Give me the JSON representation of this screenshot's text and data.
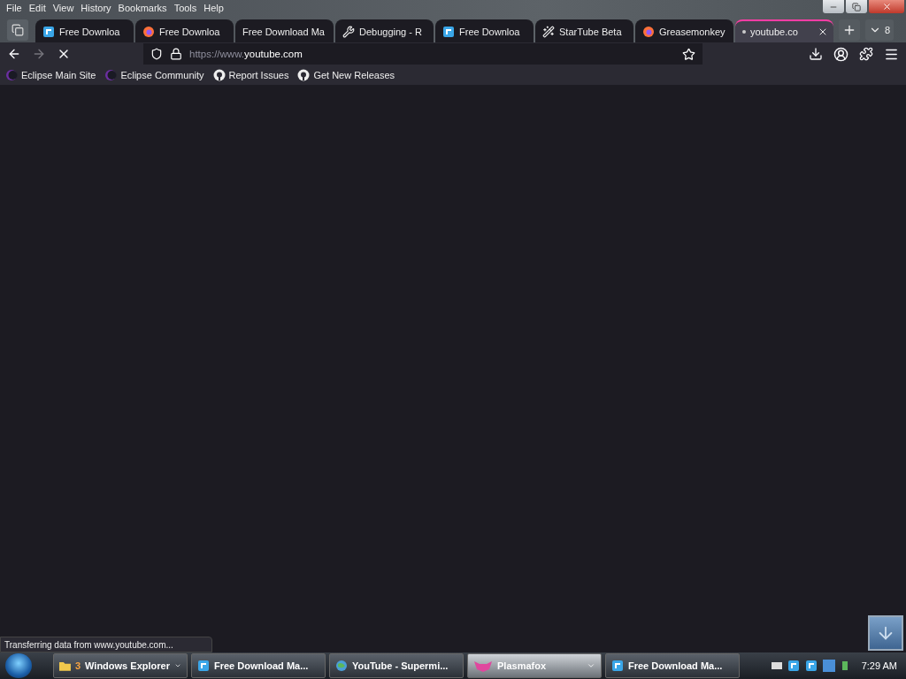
{
  "menu": [
    "File",
    "Edit",
    "View",
    "History",
    "Bookmarks",
    "Tools",
    "Help"
  ],
  "tabs": [
    {
      "label": "Free Downloa",
      "kind": "fdm",
      "selected": false
    },
    {
      "label": "Free Downloa",
      "kind": "firefox",
      "selected": false
    },
    {
      "label": "Free Download Ma",
      "kind": "none",
      "selected": false
    },
    {
      "label": "Debugging - R",
      "kind": "wrench",
      "selected": false
    },
    {
      "label": "Free Downloa",
      "kind": "fdm",
      "selected": false
    },
    {
      "label": "StarTube Beta",
      "kind": "wand",
      "selected": false
    },
    {
      "label": "Greasemonkey",
      "kind": "firefox",
      "selected": false
    },
    {
      "label": "youtube.co",
      "kind": "dot",
      "selected": true
    }
  ],
  "tab_count": "8",
  "address": {
    "prefix": "https://www.",
    "host": "youtube.com"
  },
  "bookmarks": [
    {
      "label": "Eclipse Main Site",
      "kind": "eclipse"
    },
    {
      "label": "Eclipse Community",
      "kind": "eclipse"
    },
    {
      "label": "Report Issues",
      "kind": "github"
    },
    {
      "label": "Get New Releases",
      "kind": "github"
    }
  ],
  "status_text": "Transferring data from www.youtube.com...",
  "taskbar": [
    {
      "count": "3",
      "label": "Windows Explorer",
      "kind": "folder",
      "grouped": true,
      "selected": false
    },
    {
      "label": "Free Download Ma...",
      "kind": "fdm",
      "grouped": false,
      "selected": false
    },
    {
      "label": "YouTube - Supermi...",
      "kind": "globe",
      "grouped": false,
      "selected": false
    },
    {
      "label": "Plasmafox",
      "kind": "fox",
      "grouped": true,
      "selected": true
    },
    {
      "label": "Free Download Ma...",
      "kind": "fdm",
      "grouped": false,
      "selected": false
    }
  ],
  "clock": "7:29 AM"
}
